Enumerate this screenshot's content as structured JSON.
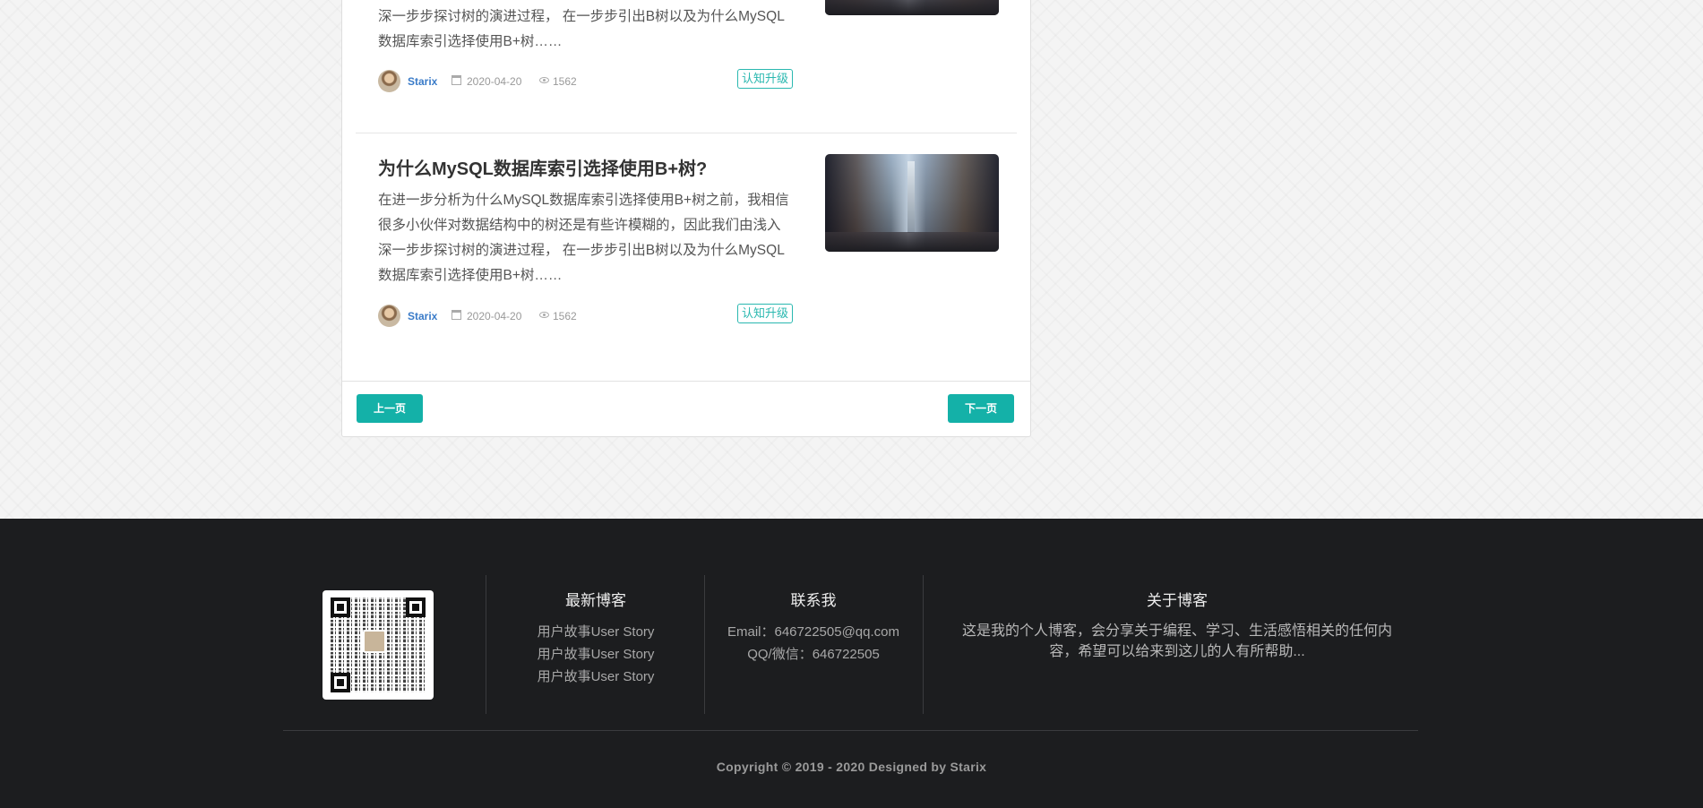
{
  "articles": [
    {
      "title": "",
      "excerpt": "在进一步分析为什么MySQL数据库索引选择使用B+树之前，我相信很多小伙伴对数据结构中的树还是有些许模糊的，因此我们由浅入深一步步探讨树的演进过程， 在一步步引出B树以及为什么MySQL数据库索引选择使用B+树……",
      "author": "Starix",
      "date": "2020-04-20",
      "views": "1562",
      "tag": "认知升级"
    },
    {
      "title": "为什么MySQL数据库索引选择使用B+树?",
      "excerpt": "在进一步分析为什么MySQL数据库索引选择使用B+树之前，我相信很多小伙伴对数据结构中的树还是有些许模糊的，因此我们由浅入深一步步探讨树的演进过程， 在一步步引出B树以及为什么MySQL数据库索引选择使用B+树……",
      "author": "Starix",
      "date": "2020-04-20",
      "views": "1562",
      "tag": "认知升级"
    }
  ],
  "pager": {
    "prev": "上一页",
    "next": "下一页"
  },
  "footer": {
    "latest": {
      "title": "最新博客",
      "items": [
        "用户故事User Story",
        "用户故事User Story",
        "用户故事User Story"
      ]
    },
    "contact": {
      "title": "联系我",
      "email": "Email：646722505@qq.com",
      "qq": "QQ/微信：646722505"
    },
    "about": {
      "title": "关于博客",
      "text_line1": "这是我的个人博客，会分享关于编程、学习、生活感悟相关的任何内",
      "text_line2": "容，希望可以给来到这儿的人有所帮助..."
    },
    "copyright": "Copyright © 2019 - 2020 Designed by Starix"
  }
}
